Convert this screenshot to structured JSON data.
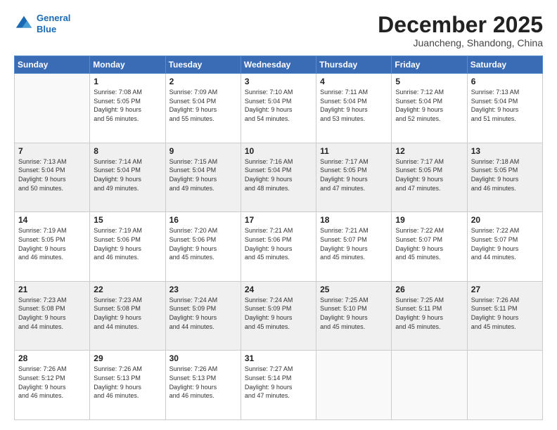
{
  "header": {
    "logo_line1": "General",
    "logo_line2": "Blue",
    "main_title": "December 2025",
    "sub_title": "Juancheng, Shandong, China"
  },
  "weekdays": [
    "Sunday",
    "Monday",
    "Tuesday",
    "Wednesday",
    "Thursday",
    "Friday",
    "Saturday"
  ],
  "weeks": [
    [
      {
        "day": "",
        "info": ""
      },
      {
        "day": "1",
        "info": "Sunrise: 7:08 AM\nSunset: 5:05 PM\nDaylight: 9 hours\nand 56 minutes."
      },
      {
        "day": "2",
        "info": "Sunrise: 7:09 AM\nSunset: 5:04 PM\nDaylight: 9 hours\nand 55 minutes."
      },
      {
        "day": "3",
        "info": "Sunrise: 7:10 AM\nSunset: 5:04 PM\nDaylight: 9 hours\nand 54 minutes."
      },
      {
        "day": "4",
        "info": "Sunrise: 7:11 AM\nSunset: 5:04 PM\nDaylight: 9 hours\nand 53 minutes."
      },
      {
        "day": "5",
        "info": "Sunrise: 7:12 AM\nSunset: 5:04 PM\nDaylight: 9 hours\nand 52 minutes."
      },
      {
        "day": "6",
        "info": "Sunrise: 7:13 AM\nSunset: 5:04 PM\nDaylight: 9 hours\nand 51 minutes."
      }
    ],
    [
      {
        "day": "7",
        "info": "Sunrise: 7:13 AM\nSunset: 5:04 PM\nDaylight: 9 hours\nand 50 minutes."
      },
      {
        "day": "8",
        "info": "Sunrise: 7:14 AM\nSunset: 5:04 PM\nDaylight: 9 hours\nand 49 minutes."
      },
      {
        "day": "9",
        "info": "Sunrise: 7:15 AM\nSunset: 5:04 PM\nDaylight: 9 hours\nand 49 minutes."
      },
      {
        "day": "10",
        "info": "Sunrise: 7:16 AM\nSunset: 5:04 PM\nDaylight: 9 hours\nand 48 minutes."
      },
      {
        "day": "11",
        "info": "Sunrise: 7:17 AM\nSunset: 5:05 PM\nDaylight: 9 hours\nand 47 minutes."
      },
      {
        "day": "12",
        "info": "Sunrise: 7:17 AM\nSunset: 5:05 PM\nDaylight: 9 hours\nand 47 minutes."
      },
      {
        "day": "13",
        "info": "Sunrise: 7:18 AM\nSunset: 5:05 PM\nDaylight: 9 hours\nand 46 minutes."
      }
    ],
    [
      {
        "day": "14",
        "info": "Sunrise: 7:19 AM\nSunset: 5:05 PM\nDaylight: 9 hours\nand 46 minutes."
      },
      {
        "day": "15",
        "info": "Sunrise: 7:19 AM\nSunset: 5:06 PM\nDaylight: 9 hours\nand 46 minutes."
      },
      {
        "day": "16",
        "info": "Sunrise: 7:20 AM\nSunset: 5:06 PM\nDaylight: 9 hours\nand 45 minutes."
      },
      {
        "day": "17",
        "info": "Sunrise: 7:21 AM\nSunset: 5:06 PM\nDaylight: 9 hours\nand 45 minutes."
      },
      {
        "day": "18",
        "info": "Sunrise: 7:21 AM\nSunset: 5:07 PM\nDaylight: 9 hours\nand 45 minutes."
      },
      {
        "day": "19",
        "info": "Sunrise: 7:22 AM\nSunset: 5:07 PM\nDaylight: 9 hours\nand 45 minutes."
      },
      {
        "day": "20",
        "info": "Sunrise: 7:22 AM\nSunset: 5:07 PM\nDaylight: 9 hours\nand 44 minutes."
      }
    ],
    [
      {
        "day": "21",
        "info": "Sunrise: 7:23 AM\nSunset: 5:08 PM\nDaylight: 9 hours\nand 44 minutes."
      },
      {
        "day": "22",
        "info": "Sunrise: 7:23 AM\nSunset: 5:08 PM\nDaylight: 9 hours\nand 44 minutes."
      },
      {
        "day": "23",
        "info": "Sunrise: 7:24 AM\nSunset: 5:09 PM\nDaylight: 9 hours\nand 44 minutes."
      },
      {
        "day": "24",
        "info": "Sunrise: 7:24 AM\nSunset: 5:09 PM\nDaylight: 9 hours\nand 45 minutes."
      },
      {
        "day": "25",
        "info": "Sunrise: 7:25 AM\nSunset: 5:10 PM\nDaylight: 9 hours\nand 45 minutes."
      },
      {
        "day": "26",
        "info": "Sunrise: 7:25 AM\nSunset: 5:11 PM\nDaylight: 9 hours\nand 45 minutes."
      },
      {
        "day": "27",
        "info": "Sunrise: 7:26 AM\nSunset: 5:11 PM\nDaylight: 9 hours\nand 45 minutes."
      }
    ],
    [
      {
        "day": "28",
        "info": "Sunrise: 7:26 AM\nSunset: 5:12 PM\nDaylight: 9 hours\nand 46 minutes."
      },
      {
        "day": "29",
        "info": "Sunrise: 7:26 AM\nSunset: 5:13 PM\nDaylight: 9 hours\nand 46 minutes."
      },
      {
        "day": "30",
        "info": "Sunrise: 7:26 AM\nSunset: 5:13 PM\nDaylight: 9 hours\nand 46 minutes."
      },
      {
        "day": "31",
        "info": "Sunrise: 7:27 AM\nSunset: 5:14 PM\nDaylight: 9 hours\nand 47 minutes."
      },
      {
        "day": "",
        "info": ""
      },
      {
        "day": "",
        "info": ""
      },
      {
        "day": "",
        "info": ""
      }
    ]
  ]
}
